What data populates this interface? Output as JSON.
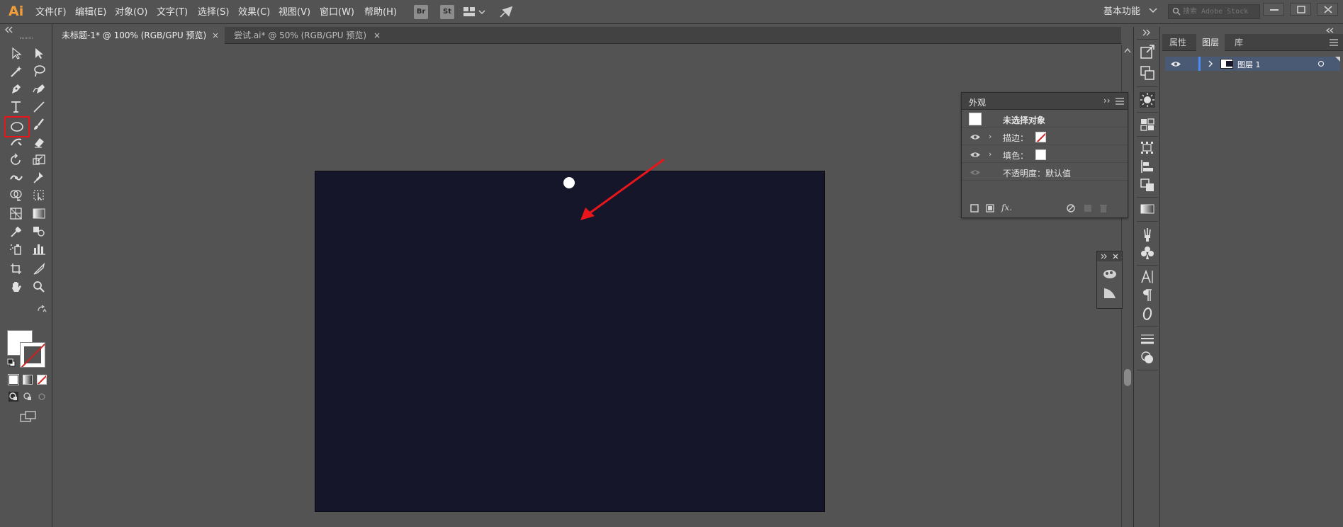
{
  "app": {
    "logo": "Ai",
    "accent_color": "#f29d3a"
  },
  "menu": {
    "items": [
      {
        "label": "文件(F)"
      },
      {
        "label": "编辑(E)"
      },
      {
        "label": "对象(O)"
      },
      {
        "label": "文字(T)"
      },
      {
        "label": "选择(S)"
      },
      {
        "label": "效果(C)"
      },
      {
        "label": "视图(V)"
      },
      {
        "label": "窗口(W)"
      },
      {
        "label": "帮助(H)"
      }
    ],
    "bridge_label": "Br",
    "stock_label": "St",
    "workspace": "基本功能",
    "search_placeholder": "搜索 Adobe Stock"
  },
  "document_tabs": [
    {
      "label": "未标题-1* @ 100% (RGB/GPU 预览)",
      "active": true,
      "close": "×"
    },
    {
      "label": "尝试.ai* @ 50% (RGB/GPU 预览)",
      "active": false,
      "close": "×"
    }
  ],
  "canvas": {
    "artboard_color": "#15162a",
    "ellipse_color": "#ffffff",
    "annotation_arrow_color": "#e8161a"
  },
  "toolbar": {
    "selected_tool": "ellipse-tool",
    "highlight_color": "#e8161a",
    "fill_color": "#ffffff",
    "stroke": "none"
  },
  "appearance_panel": {
    "title": "外观",
    "expand": "››",
    "rows": [
      {
        "label": "未选择对象"
      },
      {
        "label": "描边："
      },
      {
        "label": "填色："
      },
      {
        "label": "不透明度：默认值"
      }
    ],
    "footer_fx": "fx."
  },
  "layers_panel": {
    "tabs": [
      {
        "label": "属性",
        "active": false
      },
      {
        "label": "图层",
        "active": true
      },
      {
        "label": "库",
        "active": false
      }
    ],
    "layers": [
      {
        "name": "图层 1",
        "visible": true
      }
    ]
  }
}
